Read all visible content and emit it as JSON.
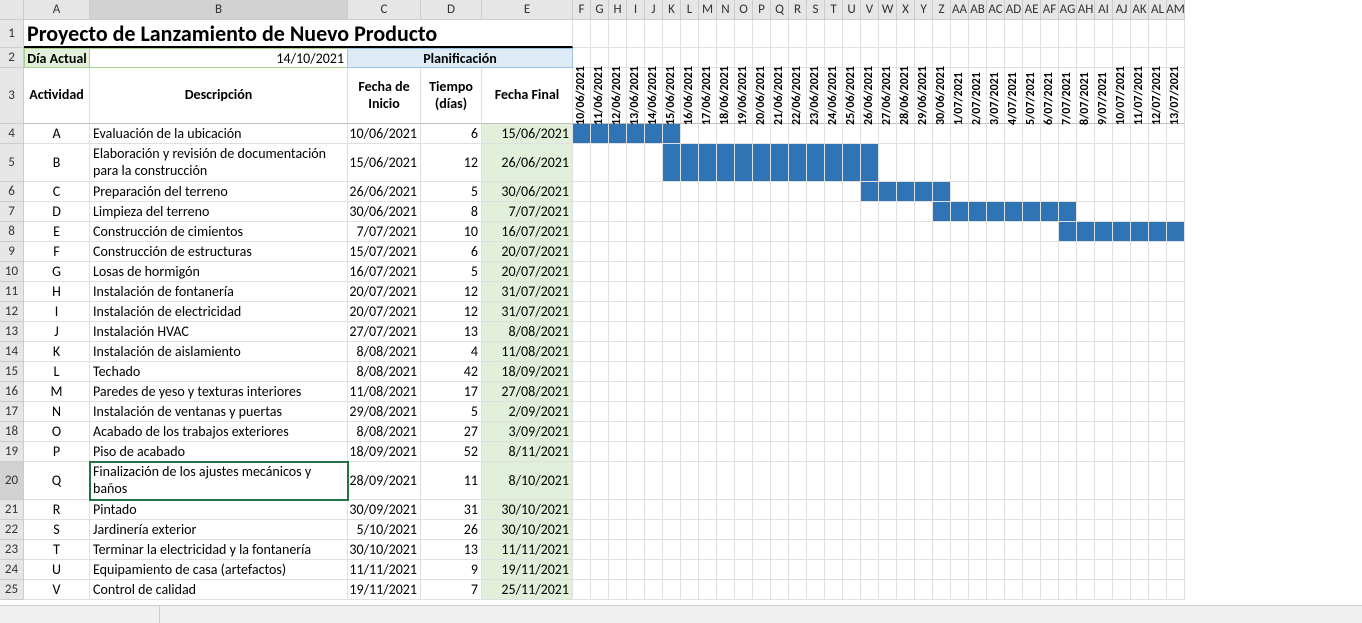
{
  "columns": [
    "A",
    "B",
    "C",
    "D",
    "E",
    "F",
    "G",
    "H",
    "I",
    "J",
    "K",
    "L",
    "M",
    "N",
    "O",
    "P",
    "Q",
    "R",
    "S",
    "T",
    "U",
    "V",
    "W",
    "X",
    "Y",
    "Z",
    "AA",
    "AB",
    "AC",
    "AD",
    "AE",
    "AF",
    "AG",
    "AH",
    "AI",
    "AJ",
    "AK",
    "AL",
    "AM"
  ],
  "rows_visible": [
    "1",
    "2",
    "3",
    "4",
    "5",
    "6",
    "7",
    "8",
    "9",
    "10",
    "11",
    "12",
    "13",
    "14",
    "15",
    "16",
    "17",
    "18",
    "19",
    "20",
    "21",
    "22",
    "23",
    "24",
    "25"
  ],
  "title": "Proyecto de Lanzamiento de Nuevo Producto",
  "dia_actual_label": "Día Actual",
  "dia_actual_value": "14/10/2021",
  "planificacion_label": "Planificación",
  "headers": {
    "actividad": "Actividad",
    "descripcion": "Descripción",
    "fecha_inicio": "Fecha de Inicio",
    "tiempo": "Tiempo (días)",
    "fecha_final": "Fecha Final"
  },
  "gantt_dates": [
    "10/06/2021",
    "11/06/2021",
    "12/06/2021",
    "13/06/2021",
    "14/06/2021",
    "15/06/2021",
    "16/06/2021",
    "17/06/2021",
    "18/06/2021",
    "19/06/2021",
    "20/06/2021",
    "21/06/2021",
    "22/06/2021",
    "23/06/2021",
    "24/06/2021",
    "25/06/2021",
    "26/06/2021",
    "27/06/2021",
    "28/06/2021",
    "29/06/2021",
    "30/06/2021",
    "1/07/2021",
    "2/07/2021",
    "3/07/2021",
    "4/07/2021",
    "5/07/2021",
    "6/07/2021",
    "7/07/2021",
    "8/07/2021",
    "9/07/2021",
    "10/07/2021",
    "11/07/2021",
    "12/07/2021",
    "13/07/2021"
  ],
  "tasks": [
    {
      "act": "A",
      "desc": "Evaluación de la ubicación",
      "start": "10/06/2021",
      "days": "6",
      "end": "15/06/2021",
      "bar_from": 0,
      "bar_to": 5
    },
    {
      "act": "B",
      "desc": "Elaboración y revisión de documentación para la construcción",
      "start": "15/06/2021",
      "days": "12",
      "end": "26/06/2021",
      "bar_from": 5,
      "bar_to": 16,
      "tall": true
    },
    {
      "act": "C",
      "desc": "Preparación del terreno",
      "start": "26/06/2021",
      "days": "5",
      "end": "30/06/2021",
      "bar_from": 16,
      "bar_to": 20
    },
    {
      "act": "D",
      "desc": "Limpieza del terreno",
      "start": "30/06/2021",
      "days": "8",
      "end": "7/07/2021",
      "bar_from": 20,
      "bar_to": 27
    },
    {
      "act": "E",
      "desc": "Construcción de cimientos",
      "start": "7/07/2021",
      "days": "10",
      "end": "16/07/2021",
      "bar_from": 27,
      "bar_to": 33
    },
    {
      "act": "F",
      "desc": "Construcción de estructuras",
      "start": "15/07/2021",
      "days": "6",
      "end": "20/07/2021",
      "bar_from": -1,
      "bar_to": -1
    },
    {
      "act": "G",
      "desc": "Losas de hormigón",
      "start": "16/07/2021",
      "days": "5",
      "end": "20/07/2021",
      "bar_from": -1,
      "bar_to": -1
    },
    {
      "act": "H",
      "desc": "Instalación de fontanería",
      "start": "20/07/2021",
      "days": "12",
      "end": "31/07/2021",
      "bar_from": -1,
      "bar_to": -1
    },
    {
      "act": "I",
      "desc": "Instalación de electricidad",
      "start": "20/07/2021",
      "days": "12",
      "end": "31/07/2021",
      "bar_from": -1,
      "bar_to": -1
    },
    {
      "act": "J",
      "desc": "Instalación HVAC",
      "start": "27/07/2021",
      "days": "13",
      "end": "8/08/2021",
      "bar_from": -1,
      "bar_to": -1
    },
    {
      "act": "K",
      "desc": "Instalación de aislamiento",
      "start": "8/08/2021",
      "days": "4",
      "end": "11/08/2021",
      "bar_from": -1,
      "bar_to": -1
    },
    {
      "act": "L",
      "desc": "Techado",
      "start": "8/08/2021",
      "days": "42",
      "end": "18/09/2021",
      "bar_from": -1,
      "bar_to": -1
    },
    {
      "act": "M",
      "desc": "Paredes de yeso y texturas interiores",
      "start": "11/08/2021",
      "days": "17",
      "end": "27/08/2021",
      "bar_from": -1,
      "bar_to": -1
    },
    {
      "act": "N",
      "desc": "Instalación de ventanas y puertas",
      "start": "29/08/2021",
      "days": "5",
      "end": "2/09/2021",
      "bar_from": -1,
      "bar_to": -1
    },
    {
      "act": "O",
      "desc": "Acabado de los trabajos exteriores",
      "start": "8/08/2021",
      "days": "27",
      "end": "3/09/2021",
      "bar_from": -1,
      "bar_to": -1
    },
    {
      "act": "P",
      "desc": "Piso de acabado",
      "start": "18/09/2021",
      "days": "52",
      "end": "8/11/2021",
      "bar_from": -1,
      "bar_to": -1
    },
    {
      "act": "Q",
      "desc": "Finalización de los ajustes mecánicos y baños",
      "start": "28/09/2021",
      "days": "11",
      "end": "8/10/2021",
      "bar_from": -1,
      "bar_to": -1,
      "tall": true,
      "selected": true
    },
    {
      "act": "R",
      "desc": "Pintado",
      "start": "30/09/2021",
      "days": "31",
      "end": "30/10/2021",
      "bar_from": -1,
      "bar_to": -1
    },
    {
      "act": "S",
      "desc": "Jardinería exterior",
      "start": "5/10/2021",
      "days": "26",
      "end": "30/10/2021",
      "bar_from": -1,
      "bar_to": -1
    },
    {
      "act": "T",
      "desc": "Terminar la electricidad y la fontanería",
      "start": "30/10/2021",
      "days": "13",
      "end": "11/11/2021",
      "bar_from": -1,
      "bar_to": -1
    },
    {
      "act": "U",
      "desc": "Equipamiento de casa (artefactos)",
      "start": "11/11/2021",
      "days": "9",
      "end": "19/11/2021",
      "bar_from": -1,
      "bar_to": -1
    },
    {
      "act": "V",
      "desc": "Control de calidad",
      "start": "19/11/2021",
      "days": "7",
      "end": "25/11/2021",
      "bar_from": -1,
      "bar_to": -1
    }
  ],
  "chart_data": {
    "type": "bar",
    "title": "Proyecto de Lanzamiento de Nuevo Producto – Gantt",
    "x_axis_dates_visible": [
      "10/06/2021",
      "11/06/2021",
      "12/06/2021",
      "13/06/2021",
      "14/06/2021",
      "15/06/2021",
      "16/06/2021",
      "17/06/2021",
      "18/06/2021",
      "19/06/2021",
      "20/06/2021",
      "21/06/2021",
      "22/06/2021",
      "23/06/2021",
      "24/06/2021",
      "25/06/2021",
      "26/06/2021",
      "27/06/2021",
      "28/06/2021",
      "29/06/2021",
      "30/06/2021",
      "1/07/2021",
      "2/07/2021",
      "3/07/2021",
      "4/07/2021",
      "5/07/2021",
      "6/07/2021",
      "7/07/2021",
      "8/07/2021",
      "9/07/2021",
      "10/07/2021",
      "11/07/2021",
      "12/07/2021",
      "13/07/2021"
    ],
    "series": [
      {
        "name": "A",
        "start": "10/06/2021",
        "duration_days": 6,
        "end": "15/06/2021"
      },
      {
        "name": "B",
        "start": "15/06/2021",
        "duration_days": 12,
        "end": "26/06/2021"
      },
      {
        "name": "C",
        "start": "26/06/2021",
        "duration_days": 5,
        "end": "30/06/2021"
      },
      {
        "name": "D",
        "start": "30/06/2021",
        "duration_days": 8,
        "end": "7/07/2021"
      },
      {
        "name": "E",
        "start": "7/07/2021",
        "duration_days": 10,
        "end": "16/07/2021"
      },
      {
        "name": "F",
        "start": "15/07/2021",
        "duration_days": 6,
        "end": "20/07/2021"
      },
      {
        "name": "G",
        "start": "16/07/2021",
        "duration_days": 5,
        "end": "20/07/2021"
      },
      {
        "name": "H",
        "start": "20/07/2021",
        "duration_days": 12,
        "end": "31/07/2021"
      },
      {
        "name": "I",
        "start": "20/07/2021",
        "duration_days": 12,
        "end": "31/07/2021"
      },
      {
        "name": "J",
        "start": "27/07/2021",
        "duration_days": 13,
        "end": "8/08/2021"
      },
      {
        "name": "K",
        "start": "8/08/2021",
        "duration_days": 4,
        "end": "11/08/2021"
      },
      {
        "name": "L",
        "start": "8/08/2021",
        "duration_days": 42,
        "end": "18/09/2021"
      },
      {
        "name": "M",
        "start": "11/08/2021",
        "duration_days": 17,
        "end": "27/08/2021"
      },
      {
        "name": "N",
        "start": "29/08/2021",
        "duration_days": 5,
        "end": "2/09/2021"
      },
      {
        "name": "O",
        "start": "8/08/2021",
        "duration_days": 27,
        "end": "3/09/2021"
      },
      {
        "name": "P",
        "start": "18/09/2021",
        "duration_days": 52,
        "end": "8/11/2021"
      },
      {
        "name": "Q",
        "start": "28/09/2021",
        "duration_days": 11,
        "end": "8/10/2021"
      },
      {
        "name": "R",
        "start": "30/09/2021",
        "duration_days": 31,
        "end": "30/10/2021"
      },
      {
        "name": "S",
        "start": "5/10/2021",
        "duration_days": 26,
        "end": "30/10/2021"
      },
      {
        "name": "T",
        "start": "30/10/2021",
        "duration_days": 13,
        "end": "11/11/2021"
      },
      {
        "name": "U",
        "start": "11/11/2021",
        "duration_days": 9,
        "end": "19/11/2021"
      },
      {
        "name": "V",
        "start": "19/11/2021",
        "duration_days": 7,
        "end": "25/11/2021"
      }
    ]
  }
}
